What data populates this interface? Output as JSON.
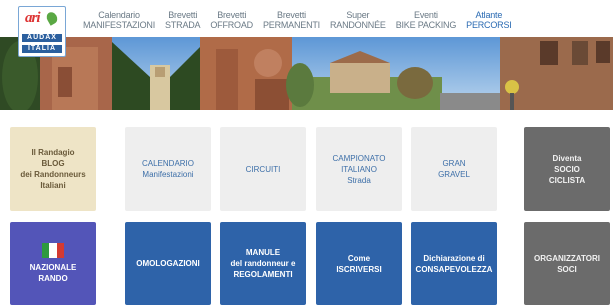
{
  "logo": {
    "brand": "ari",
    "line1": "AUDAX",
    "line2": "ITALIA"
  },
  "nav": [
    {
      "line1": "Calendario",
      "line2": "MANIFESTAZIONI",
      "active": false
    },
    {
      "line1": "Brevetti",
      "line2": "STRADA",
      "active": false
    },
    {
      "line1": "Brevetti",
      "line2": "OFFROAD",
      "active": false
    },
    {
      "line1": "Brevetti",
      "line2": "PERMANENTI",
      "active": false
    },
    {
      "line1": "Super",
      "line2": "RANDONNÉE",
      "active": false
    },
    {
      "line1": "Eventi",
      "line2": "BIKE PACKING",
      "active": false
    },
    {
      "line1": "Atlante",
      "line2": "PERCORSI",
      "active": true
    }
  ],
  "row1": [
    {
      "lines": [
        "Il Randagio",
        "BLOG",
        "dei Randonneurs",
        "Italiani"
      ],
      "style": "beige"
    },
    {
      "lines": [
        "CALENDARIO",
        "Manifestazioni"
      ],
      "style": "light"
    },
    {
      "lines": [
        "CIRCUITI"
      ],
      "style": "light"
    },
    {
      "lines": [
        "CAMPIONATO",
        "ITALIANO",
        "Strada"
      ],
      "style": "light"
    },
    {
      "lines": [
        "GRAN",
        "GRAVEL"
      ],
      "style": "light"
    },
    {
      "lines": [
        "Diventa",
        "SOCIO",
        "CICLISTA"
      ],
      "style": "gray"
    }
  ],
  "row2": [
    {
      "lines": [
        "NAZIONALE",
        "RANDO"
      ],
      "style": "purple",
      "icon": "italian-flag-icon"
    },
    {
      "lines": [
        "OMOLOGAZIONI"
      ],
      "style": "blue"
    },
    {
      "lines": [
        "MANULE",
        "del randonneur e",
        "REGOLAMENTI"
      ],
      "style": "blue"
    },
    {
      "lines": [
        "Come",
        "ISCRIVERSI"
      ],
      "style": "blue"
    },
    {
      "lines": [
        "Dichiarazione di",
        "CONSAPEVOLEZZA"
      ],
      "style": "blue"
    },
    {
      "lines": [
        "ORGANIZZATORI",
        "SOCI"
      ],
      "style": "gray"
    }
  ]
}
